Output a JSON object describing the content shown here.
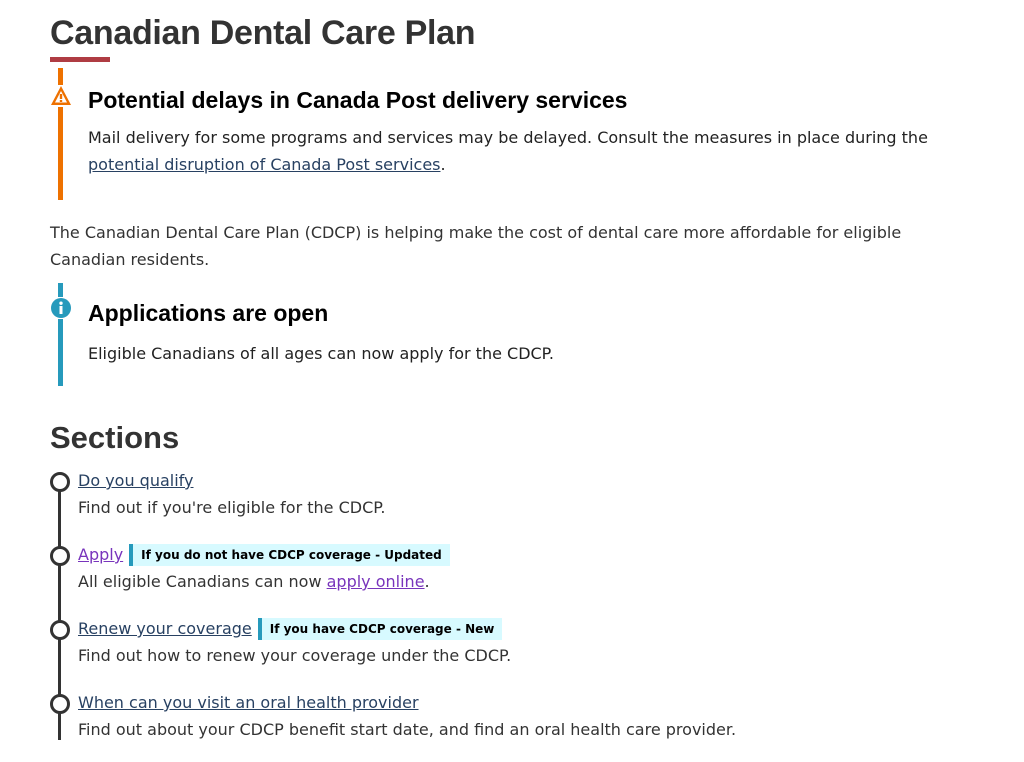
{
  "page": {
    "title": "Canadian Dental Care Plan"
  },
  "warning_alert": {
    "heading": "Potential delays in Canada Post delivery services",
    "text_before": "Mail delivery for some programs and services may be delayed. Consult the measures in place during the ",
    "link": "potential disruption of Canada Post services",
    "text_after": ".",
    "icon": "warning-icon",
    "color": "#ee7100"
  },
  "intro": "The Canadian Dental Care Plan (CDCP) is helping make the cost of dental care more affordable for eligible Canadian residents.",
  "info_alert": {
    "heading": "Applications are open",
    "text": "Eligible Canadians of all ages can now apply for the CDCP.",
    "icon": "info-icon",
    "color": "#269abc"
  },
  "sections": {
    "heading": "Sections",
    "items": [
      {
        "link": "Do you qualify",
        "desc": "Find out if you're eligible for the CDCP."
      },
      {
        "link": "Apply",
        "badge": "If you do not have CDCP coverage - Updated",
        "desc_before": "All eligible Canadians can now ",
        "desc_link": "apply online",
        "desc_after": "."
      },
      {
        "link": "Renew your coverage",
        "badge": "If you have CDCP coverage - New",
        "desc": "Find out how to renew your coverage under the CDCP."
      },
      {
        "link": "When can you visit an oral health provider",
        "desc": "Find out about your CDCP benefit start date, and find an oral health care provider."
      }
    ]
  },
  "colors": {
    "accent_red": "#af3c43",
    "link": "#284162",
    "visited_link": "#7834bc",
    "badge_bg": "#d7faff"
  }
}
